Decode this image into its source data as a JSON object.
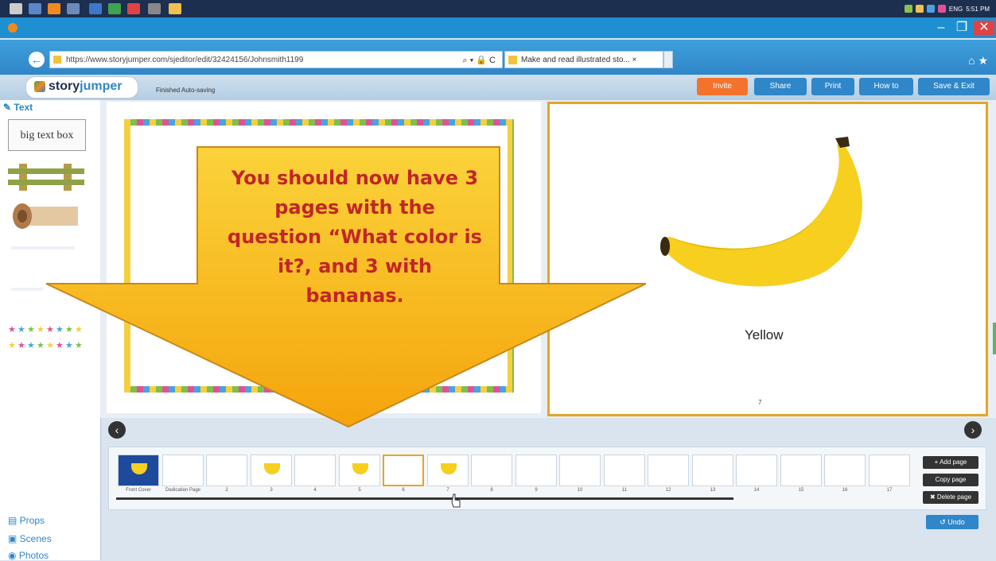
{
  "window": {
    "minimize": "–",
    "restore": "❐",
    "close": "✕"
  },
  "browser": {
    "url": "https://www.storyjumper.com/sjeditor/edit/32424156/Johnsmith1199",
    "url_controls": "⌕ ▾ 🔒 C",
    "tab_title": "Make and read illustrated sto... ×",
    "toolbar_icons": "⌂ ★"
  },
  "app": {
    "logo_story": "story",
    "logo_jumper": "jumper",
    "autosave_status": "Finished Auto-saving",
    "buttons": {
      "invite": "Invite",
      "share": "Share",
      "print": "Print",
      "how_to": "How to",
      "save_exit": "Save & Exit"
    }
  },
  "left_panel": {
    "text_header": "Text",
    "text_box_label": "big text box",
    "links": {
      "props": "Props",
      "scenes": "Scenes",
      "photos": "Photos"
    }
  },
  "right_page": {
    "caption": "Yellow",
    "page_number": "7"
  },
  "overlay": {
    "lines": [
      "You should now have 3",
      "pages with the",
      "question “What color is",
      "it?, and 3 with",
      "bananas."
    ]
  },
  "thumbnails": {
    "labels": [
      "Front Cover",
      "Dedication Page",
      "2",
      "3",
      "4",
      "5",
      "6",
      "7",
      "8",
      "9",
      "10",
      "11",
      "12",
      "13",
      "14",
      "15",
      "16",
      "17"
    ]
  },
  "page_actions": {
    "add": "+ Add page",
    "copy": "Copy page",
    "delete": "✖ Delete page",
    "undo": "Undo"
  },
  "taskbar": {
    "time": "5:51 PM",
    "lang": "ENG"
  },
  "colors": {
    "accent": "#2f86c8",
    "invite": "#f3722c",
    "arrow_fill": "#f9b916",
    "arrow_text": "#c12626",
    "selected_border": "#e2a52a"
  }
}
